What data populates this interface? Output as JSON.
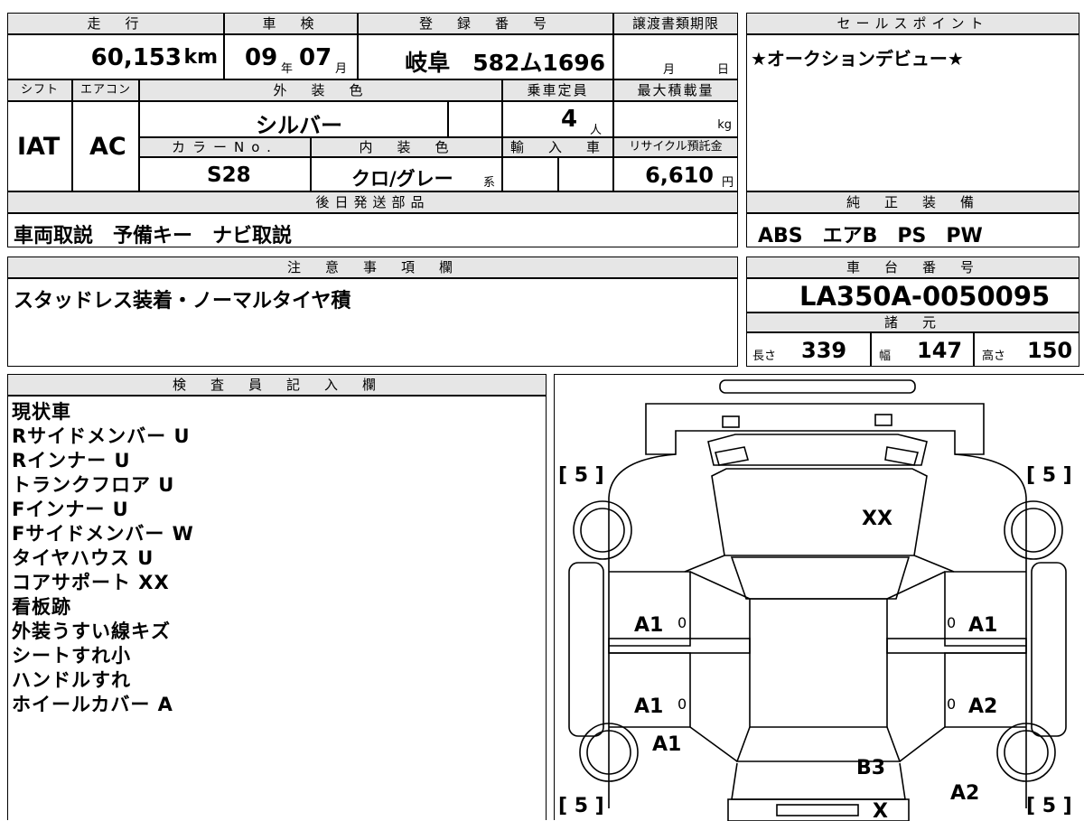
{
  "summary": {
    "h_mileage": "走　行",
    "mileage_value": "60,153",
    "mileage_unit": "km",
    "h_inspection": "車　検",
    "inspection_year": "09",
    "inspection_year_unit": "年",
    "inspection_month": "07",
    "inspection_month_unit": "月",
    "h_registration": "登　録　番　号",
    "registration": "岐阜　582ム1696",
    "h_transfer_deadline": "譲渡書類期限",
    "transfer_month_unit": "月",
    "transfer_day_unit": "日",
    "h_shift": "シフト",
    "shift_value": "IAT",
    "h_aircon": "エアコン",
    "aircon_value": "AC",
    "h_exterior_color": "外　装　色",
    "exterior_color_value": "シルバー",
    "h_color_no": "カラーNo.",
    "color_no_value": "S28",
    "h_interior_color": "内　装　色",
    "interior_color_value": "クロ/グレー",
    "interior_suffix": "系",
    "h_capacity": "乗車定員",
    "capacity_value": "4",
    "capacity_unit": "人",
    "h_max_load": "最大積載量",
    "max_load_unit": "kg",
    "h_import": "輸　入　車",
    "h_recycle": "リサイクル預託金",
    "recycle_value": "6,610",
    "recycle_unit": "円"
  },
  "sales_points": {
    "header": "セールスポイント",
    "text": "★オークションデビュー★"
  },
  "later_parts": {
    "header": "後日発送部品",
    "text": "車両取説　予備キー　ナビ取説"
  },
  "genuine_equipment": {
    "header": "純　正　装　備",
    "text": "ABS　エアB　PS　PW"
  },
  "notes": {
    "header": "注　意　事　項　欄",
    "text": "スタッドレス装着・ノーマルタイヤ積"
  },
  "chassis": {
    "header": "車　台　番　号",
    "value": "LA350A-0050095",
    "dims_header": "諸　元",
    "length_label": "長さ",
    "length_value": "339",
    "width_label": "幅",
    "width_value": "147",
    "height_label": "高さ",
    "height_value": "150"
  },
  "inspector": {
    "header": "検　査　員　記　入　欄",
    "lines": [
      "現状車",
      "Rサイドメンバー U",
      "Rインナー U",
      "トランクフロア U",
      "Fインナー U",
      "Fサイドメンバー W",
      "タイヤハウス U",
      "コアサポート XX",
      "看板跡",
      "外装うすい線キズ",
      "シートすれ小",
      "ハンドルすれ",
      "ホイールカバー A"
    ]
  },
  "diagram": {
    "tire_fl": "[ 5 ]",
    "tire_fr": "[ 5 ]",
    "tire_rl": "[ 5 ]",
    "tire_rr": "[ 5 ]",
    "hood_mark": "XX",
    "left_front_door": "A1",
    "right_front_door": "A1",
    "left_rear_door": "A1",
    "right_rear_door": "A2",
    "left_rear_fender": "A1",
    "roof_rear": "B3",
    "right_rear_fender": "A2",
    "rear_mark": "X",
    "door_zero_1": "0",
    "door_zero_2": "0",
    "door_zero_3": "0",
    "door_zero_4": "0"
  }
}
